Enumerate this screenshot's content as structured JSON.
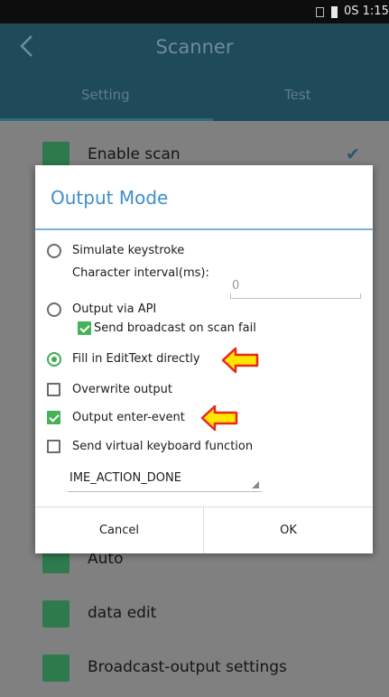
{
  "status_bar": {
    "time": "0S 1:15"
  },
  "app_bar": {
    "title": "Scanner"
  },
  "tabs": [
    {
      "label": "Setting"
    },
    {
      "label": "Test"
    }
  ],
  "background_items": [
    {
      "label": "Enable scan",
      "checked": true
    },
    {
      "label": "Auto"
    },
    {
      "label": "data edit"
    },
    {
      "label": "Broadcast-output settings"
    }
  ],
  "dialog": {
    "title": "Output Mode",
    "simulate_keystroke": {
      "label": "Simulate keystroke",
      "selected": false
    },
    "char_interval": {
      "label": "Character interval(ms):",
      "value": "0"
    },
    "output_api": {
      "label": "Output via API",
      "selected": false
    },
    "send_broadcast": {
      "label": "Send broadcast on scan fail",
      "checked": true
    },
    "fill_edittext": {
      "label": "Fill in EditText directly",
      "selected": true
    },
    "overwrite": {
      "label": "Overwrite output",
      "checked": false
    },
    "enter_event": {
      "label": "Output enter-event",
      "checked": true
    },
    "virtual_keyboard": {
      "label": "Send virtual keyboard function",
      "checked": false
    },
    "ime_action": {
      "value": "IME_ACTION_DONE"
    },
    "cancel_label": "Cancel",
    "ok_label": "OK"
  },
  "colors": {
    "accent": "#3e8fcb",
    "checkbox_green": "#45b25a",
    "annotation_arrow_fill": "#ffe500",
    "annotation_arrow_stroke": "#e8281e"
  }
}
